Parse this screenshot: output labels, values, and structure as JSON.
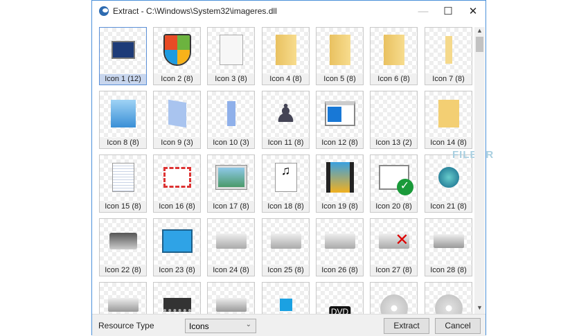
{
  "window": {
    "title": "Extract - C:\\Windows\\System32\\imageres.dll",
    "minimize": "—",
    "maximize": "☐",
    "close": "✕"
  },
  "icons": [
    {
      "label": "Icon 1 (12)",
      "type": "monitor",
      "selected": true
    },
    {
      "label": "Icon 2 (8)",
      "type": "shield"
    },
    {
      "label": "Icon 3 (8)",
      "type": "page"
    },
    {
      "label": "Icon 4 (8)",
      "type": "folder"
    },
    {
      "label": "Icon 5 (8)",
      "type": "folder"
    },
    {
      "label": "Icon 6 (8)",
      "type": "folder"
    },
    {
      "label": "Icon 7 (8)",
      "type": "folder-thin"
    },
    {
      "label": "Icon 8 (8)",
      "type": "blue-search"
    },
    {
      "label": "Icon 9 (3)",
      "type": "blue-page"
    },
    {
      "label": "Icon 10 (3)",
      "type": "blue-thin"
    },
    {
      "label": "Icon 11 (8)",
      "type": "games"
    },
    {
      "label": "Icon 12 (8)",
      "type": "window"
    },
    {
      "label": "Icon 13 (2)",
      "type": "blank"
    },
    {
      "label": "Icon 14 (8)",
      "type": "folder-search"
    },
    {
      "label": "Icon 15 (8)",
      "type": "text-doc"
    },
    {
      "label": "Icon 16 (8)",
      "type": "mail"
    },
    {
      "label": "Icon 17 (8)",
      "type": "picture"
    },
    {
      "label": "Icon 18 (8)",
      "type": "music"
    },
    {
      "label": "Icon 19 (8)",
      "type": "video"
    },
    {
      "label": "Icon 20 (8)",
      "type": "check"
    },
    {
      "label": "Icon 21 (8)",
      "type": "network"
    },
    {
      "label": "Icon 22 (8)",
      "type": "printer"
    },
    {
      "label": "Icon 23 (8)",
      "type": "control-panel"
    },
    {
      "label": "Icon 24 (8)",
      "type": "floppy"
    },
    {
      "label": "Icon 25 (8)",
      "type": "floppy"
    },
    {
      "label": "Icon 26 (8)",
      "type": "cd-drive"
    },
    {
      "label": "Icon 27 (8)",
      "type": "drive-x"
    },
    {
      "label": "Icon 28 (8)",
      "type": "drive"
    },
    {
      "type": "drive"
    },
    {
      "type": "chip"
    },
    {
      "type": "drive"
    },
    {
      "type": "win-drive"
    },
    {
      "type": "dvd"
    },
    {
      "type": "disc"
    },
    {
      "type": "disc"
    }
  ],
  "dvd_label": "DVD",
  "watermark": "FILECR",
  "bottom": {
    "resource_type_label": "Resource Type",
    "resource_type_value": "Icons",
    "extract": "Extract",
    "cancel": "Cancel"
  }
}
